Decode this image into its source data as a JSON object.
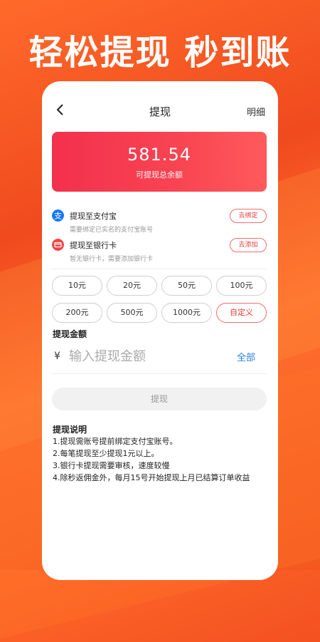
{
  "headline": "轻松提现 秒到账",
  "nav": {
    "title": "提现",
    "detail": "明细"
  },
  "balance": {
    "amount": "581.54",
    "label": "可提现总余额"
  },
  "methods": [
    {
      "title": "提现至支付宝",
      "desc": "需要绑定已实名的支付宝账号",
      "action": "去绑定",
      "icon": "alipay-icon",
      "color": "#1677ff"
    },
    {
      "title": "提现至银行卡",
      "desc": "暂无银行卡，需要添加银行卡",
      "action": "去添加",
      "icon": "bank-card-icon",
      "color": "#f04545"
    }
  ],
  "amount_options": [
    "10元",
    "20元",
    "50元",
    "100元",
    "200元",
    "500元",
    "1000元",
    "自定义"
  ],
  "amount": {
    "label": "提现金额",
    "currency": "¥",
    "placeholder": "输入提现金额",
    "all": "全部"
  },
  "submit": {
    "label": "提现"
  },
  "notes": {
    "title": "提现说明",
    "items": [
      "1.提现需账号提前绑定支付宝账号。",
      "2.每笔提现至少提现1元以上。",
      "3.银行卡提现需要审核，速度较慢",
      "4.除秒返佣金外，每月15号开始提现上月已结算订单收益"
    ]
  },
  "colors": {
    "accent": "#f3304d",
    "link": "#2d7fdf",
    "background": "#f04a1e"
  }
}
